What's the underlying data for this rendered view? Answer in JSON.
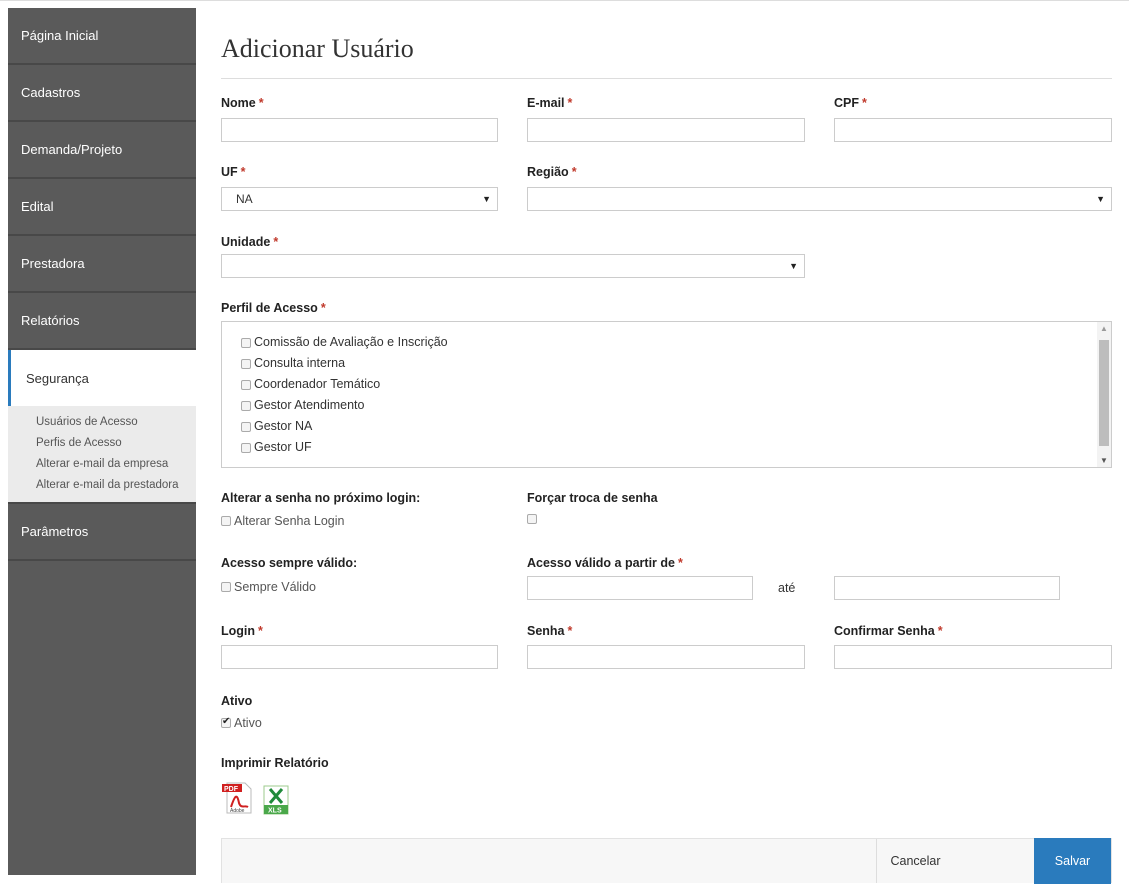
{
  "nav": {
    "items": [
      {
        "label": "Página Inicial"
      },
      {
        "label": "Cadastros"
      },
      {
        "label": "Demanda/Projeto"
      },
      {
        "label": "Edital"
      },
      {
        "label": "Prestadora"
      },
      {
        "label": "Relatórios"
      },
      {
        "label": "Segurança"
      },
      {
        "label": "Parâmetros"
      }
    ],
    "submenu": [
      {
        "label": "Usuários de Acesso"
      },
      {
        "label": "Perfis de Acesso"
      },
      {
        "label": "Alterar e-mail da empresa"
      },
      {
        "label": "Alterar e-mail da prestadora"
      }
    ]
  },
  "page": {
    "title": "Adicionar Usuário"
  },
  "form": {
    "required_mark": "*",
    "nome": {
      "label": "Nome",
      "value": ""
    },
    "email": {
      "label": "E-mail",
      "value": ""
    },
    "cpf": {
      "label": "CPF",
      "value": ""
    },
    "uf": {
      "label": "UF",
      "value": "NA"
    },
    "regiao": {
      "label": "Região",
      "value": ""
    },
    "unidade": {
      "label": "Unidade",
      "value": ""
    },
    "perfil": {
      "label": "Perfil de Acesso",
      "options": [
        {
          "label": "Comissão de Avaliação e Inscrição",
          "checked": false
        },
        {
          "label": "Consulta interna",
          "checked": false
        },
        {
          "label": "Coordenador Temático",
          "checked": false
        },
        {
          "label": "Gestor Atendimento",
          "checked": false
        },
        {
          "label": "Gestor NA",
          "checked": false
        },
        {
          "label": "Gestor UF",
          "checked": false
        }
      ]
    },
    "alterar_senha": {
      "label": "Alterar a senha no próximo login:",
      "checkbox_label": "Alterar Senha Login",
      "checked": false
    },
    "forcar_troca": {
      "label": "Forçar troca de senha",
      "checked": false
    },
    "acesso_sempre": {
      "label": "Acesso sempre válido:",
      "checkbox_label": "Sempre Válido",
      "checked": false
    },
    "acesso_valido": {
      "label": "Acesso válido a partir de",
      "from": "",
      "until_label": "até",
      "to": ""
    },
    "login": {
      "label": "Login",
      "value": ""
    },
    "senha": {
      "label": "Senha",
      "value": ""
    },
    "confirmar_senha": {
      "label": "Confirmar Senha",
      "value": ""
    },
    "ativo": {
      "label": "Ativo",
      "checkbox_label": "Ativo",
      "checked": true
    },
    "imprimir": {
      "label": "Imprimir Relatório",
      "pdf_icon": "pdf-icon",
      "xls_icon": "xls-icon",
      "pdf_text": "PDF",
      "pdf_brand": "Adobe",
      "xls_text": "XLS"
    }
  },
  "footer": {
    "cancel_label": "Cancelar",
    "save_label": "Salvar"
  },
  "colors": {
    "sidebar": "#5a5a5a",
    "accent": "#2a7bbd",
    "required": "#c0392b"
  }
}
